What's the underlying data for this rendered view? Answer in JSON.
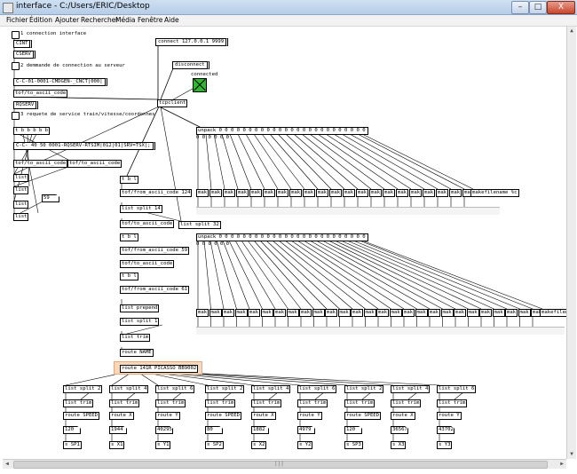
{
  "window": {
    "title": "interface - C:/Users/ERIC/Desktop",
    "minimize": "–",
    "maximize": "□",
    "close": "X"
  },
  "menubar": [
    "Fichier",
    "Édition",
    "Ajouter",
    "Rechercher",
    "Média",
    "Fenêtre",
    "Aide"
  ],
  "patch": {
    "comments": {
      "c1": "1 connection interface",
      "c2": "2 demmande de connection au serveur",
      "c3": "3 requete de service train/vitesse/coordonnes"
    },
    "connect_msg": "connect 127.0.0.1 9999",
    "disconnect_msg": "disconnect",
    "connected_label": "connected",
    "cint_msg": "CINT",
    "cserv_msg": "CSERV",
    "cmdgen_msg": "C-C-01-0001-CMDGEN-_CNCT|000|",
    "tof_ascii_1": "tof/to_ascii_code",
    "rqserv_msg": "RQSERV",
    "tcpclient": "tcpclient",
    "tbbbbb": "t b b b b b",
    "rqserv_full": "C-C- 40 50 0001-RQSERV-RTSIM|012|01|SRV=TSX|;",
    "tof_ascii_2": "tof/to_ascii_code",
    "tof_ascii_3": "tof/to_ascii_code",
    "list_a": "list",
    "list_b": "list",
    "list_c": "list",
    "list_d": "list",
    "num_59": "59",
    "tbl_1": "t b l",
    "from_ascii_124": "tof/from_ascii_code 124",
    "list_split_14": "list split 14",
    "to_ascii_x": "tof/to_ascii_code",
    "tbl_2": "t b l",
    "from_ascii_59": "tof/from_ascii_code 59",
    "to_ascii_y": "tof/to_ascii_code",
    "tbl_3": "t b l",
    "from_ascii_61": "tof/from_ascii_code 61",
    "list_prepend": "list prepend",
    "list_split_1": "list split 1",
    "list_trim": "list trim",
    "route_name": "route NAME",
    "route_trains": "route 141R PICASSO BB9002",
    "list_split_32": "list split 32",
    "unpack_1": "unpack 0 0 0 0 0 0 0 0 0 0 0 0 0 0 0 0 0 0 0 0 0 0 0 0 0 0 0 0 0 0 0 0 0 0 0 0 0 0 0 0 0 0 0 0 0 0 0",
    "unpack_1b": "0 0 0 0 0 0",
    "unpack_2": "unpack 0 0 0 0 0 0 0 0 0 0 0 0 0 0 0 0 0 0 0 0 0 0 0 0 0 0 0 0 0 0 0 0 0 0 0 0 0 0 0 0 0 0 0 0 0 0 0",
    "unpack_2b": "0 0 0 0 0 0",
    "makfilename_1": "makefilename %c",
    "makfilename_2": "makefilen",
    "mak": "mak",
    "list_split_labels": [
      "list split 2",
      "list split 4",
      "list split 6",
      "list split 2",
      "list split 4",
      "list split 6",
      "list split 2",
      "list split 4",
      "list split 6"
    ],
    "columns": [
      {
        "route": "route SPEED",
        "value": "120",
        "send": "s SP1"
      },
      {
        "route": "route X",
        "value": "1944",
        "send": "s X1"
      },
      {
        "route": "route Y",
        "value": "40295",
        "send": "s Y1"
      },
      {
        "route": "route SPEED",
        "value": "80",
        "send": "s SP2"
      },
      {
        "route": "route X",
        "value": "1882",
        "send": "s X2"
      },
      {
        "route": "route Y",
        "value": "4979",
        "send": "s Y2"
      },
      {
        "route": "route SPEED",
        "value": "120",
        "send": "s SP3"
      },
      {
        "route": "route X",
        "value": "36567",
        "send": "s X3"
      },
      {
        "route": "route Y",
        "value": "43702",
        "send": "s Y3"
      }
    ]
  },
  "colors": {
    "toggle": "#2fb72f",
    "highlight": "#f9d9bc"
  }
}
